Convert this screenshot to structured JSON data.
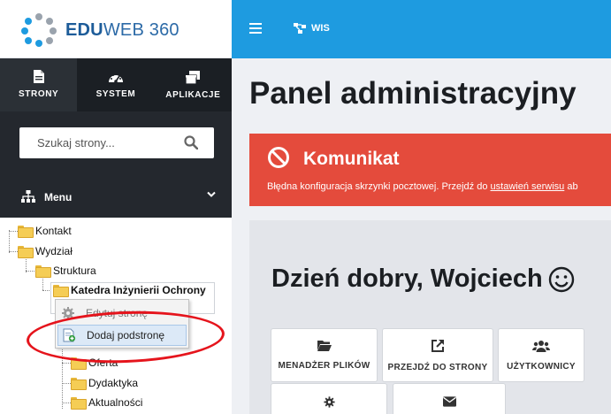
{
  "brand": {
    "name_bold": "EDU",
    "name_rest": "WEB 360"
  },
  "sidebar": {
    "tabs": [
      {
        "label": "STRONY",
        "icon": "document-icon",
        "active": true
      },
      {
        "label": "SYSTEM",
        "icon": "gauge-icon",
        "active": false
      },
      {
        "label": "APLIKACJE",
        "icon": "windows-icon",
        "active": false
      }
    ],
    "search": {
      "placeholder": "Szukaj strony..."
    },
    "menu_label": "Menu"
  },
  "tree": {
    "kontakt": "Kontakt",
    "wydzial": "Wydział",
    "struktura": "Struktura",
    "katedra": "Katedra Inżynierii Ochrony",
    "oferta": "Oferta",
    "dydaktyka": "Dydaktyka",
    "aktualnosci": "Aktualności"
  },
  "context_menu": {
    "edit": "Edytuj stronę",
    "add": "Dodaj podstronę"
  },
  "topbar": {
    "breadcrumb": "WIS"
  },
  "main": {
    "title": "Panel administracyjny",
    "alert": {
      "title": "Komunikat",
      "text": "Błędna konfiguracja skrzynki pocztowej. Przejdź do",
      "link": "ustawień serwisu",
      "tail": "ab"
    },
    "greeting": "Dzień dobry, Wojciech",
    "tiles": [
      {
        "label": "MENADŻER PLIKÓW",
        "icon": "folder-open-icon"
      },
      {
        "label": "PRZEJDŹ DO STRONY",
        "icon": "external-link-icon"
      },
      {
        "label": "UŻYTKOWNICY",
        "icon": "users-icon"
      },
      {
        "label": "",
        "icon": "gear-icon"
      },
      {
        "label": "",
        "icon": "envelope-icon"
      }
    ]
  },
  "colors": {
    "topbar": "#1e9be0",
    "alert": "#e44b3c",
    "sidebar_dark": "#24282e",
    "annotation": "#e5141c"
  }
}
